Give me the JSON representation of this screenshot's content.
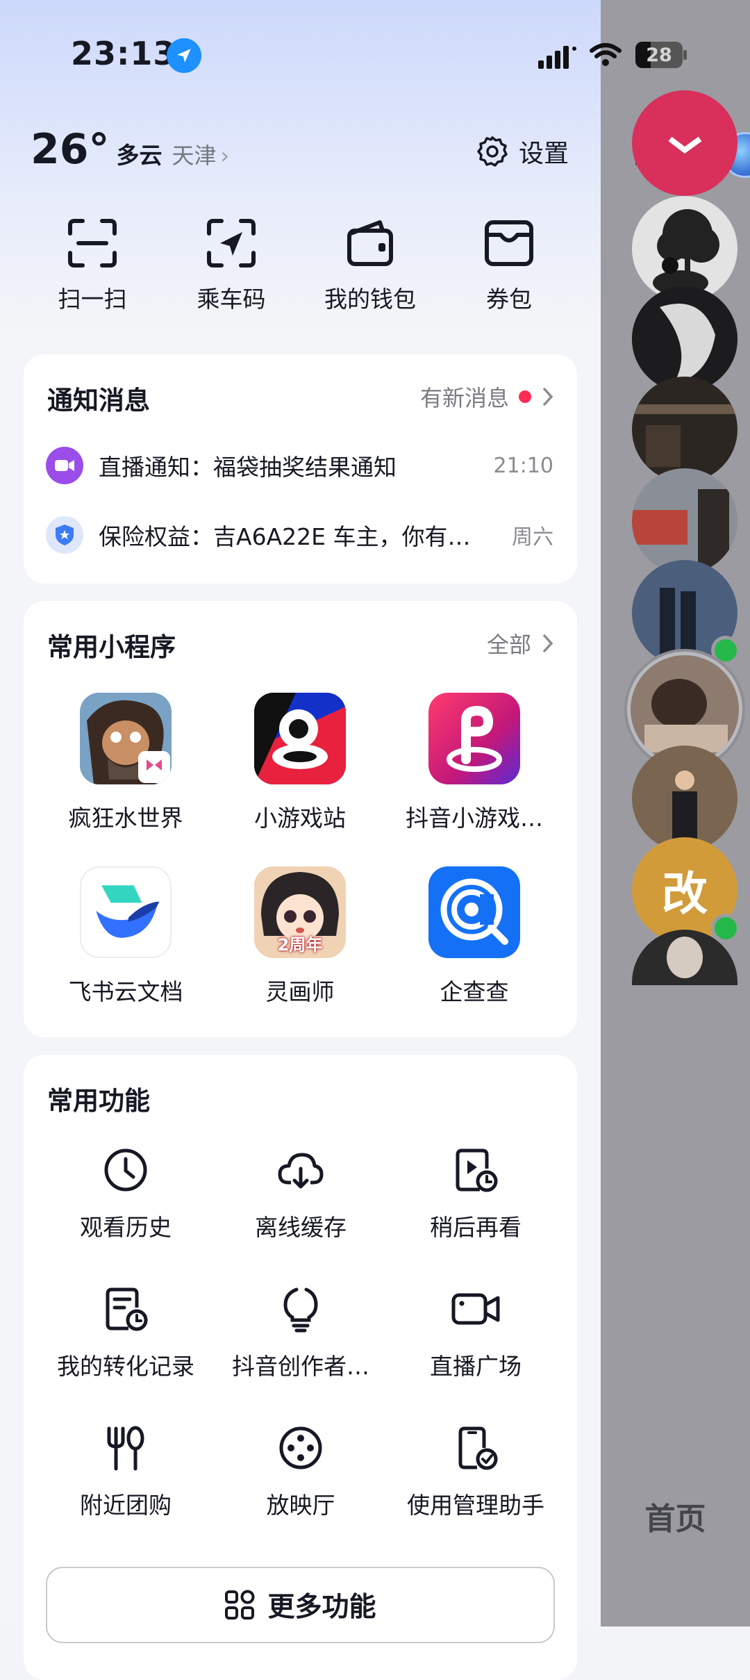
{
  "status_bar": {
    "time": "23:13",
    "battery": "28"
  },
  "header": {
    "temperature": "26°",
    "weather": "多云",
    "city": "天津",
    "settings_label": "设置"
  },
  "quick_actions": [
    {
      "label": "扫一扫",
      "icon": "scan-icon"
    },
    {
      "label": "乘车码",
      "icon": "ride-code-icon"
    },
    {
      "label": "我的钱包",
      "icon": "wallet-icon"
    },
    {
      "label": "券包",
      "icon": "coupon-icon"
    }
  ],
  "notifications": {
    "title": "通知消息",
    "more_label": "有新消息",
    "items": [
      {
        "text": "直播通知：福袋抽奖结果通知",
        "time": "21:10",
        "icon": "live-camera-icon",
        "color": "#9b4dea"
      },
      {
        "text": "保险权益：吉A6A22E 车主，你有…",
        "time": "周六",
        "icon": "shield-star-icon",
        "color": "#3d7bf5"
      }
    ]
  },
  "mini_programs": {
    "title": "常用小程序",
    "more_label": "全部",
    "items": [
      {
        "label": "疯狂水世界"
      },
      {
        "label": "小游戏站"
      },
      {
        "label": "抖音小游戏…"
      },
      {
        "label": "飞书云文档"
      },
      {
        "label": "灵画师",
        "badge": "2周年"
      },
      {
        "label": "企查查"
      }
    ]
  },
  "functions": {
    "title": "常用功能",
    "items": [
      {
        "label": "观看历史",
        "icon": "clock-icon"
      },
      {
        "label": "离线缓存",
        "icon": "cloud-download-icon"
      },
      {
        "label": "稍后再看",
        "icon": "watch-later-icon"
      },
      {
        "label": "我的转化记录",
        "icon": "record-icon"
      },
      {
        "label": "抖音创作者…",
        "icon": "lightbulb-icon"
      },
      {
        "label": "直播广场",
        "icon": "video-camera-icon"
      },
      {
        "label": "附近团购",
        "icon": "fork-spoon-icon"
      },
      {
        "label": "放映厅",
        "icon": "film-reel-icon"
      },
      {
        "label": "使用管理助手",
        "icon": "phone-check-icon"
      }
    ],
    "more_label": "更多功能"
  },
  "right_panel": {
    "avatar_text": "改",
    "home_label": "首页"
  },
  "colors": {
    "accent_red": "#fe2c55",
    "online_green": "#25b84a"
  }
}
